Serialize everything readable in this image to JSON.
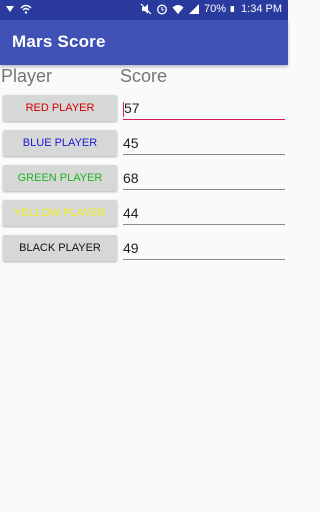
{
  "status_bar": {
    "battery": "70%",
    "time": "1:34 PM",
    "icons": [
      "notification-icon",
      "wifi-icon",
      "mute-icon",
      "alarm-icon",
      "wifi-icon",
      "signal-icon",
      "battery-icon"
    ]
  },
  "app": {
    "title": "Mars Score",
    "primary_color": "#3f51b5",
    "status_color": "#2a3a9e",
    "accent_color": "#d81b60"
  },
  "headers": {
    "player": "Player",
    "score": "Score"
  },
  "players": [
    {
      "label": "RED PLAYER",
      "color": "#d50000",
      "score": "57"
    },
    {
      "label": "BLUE PLAYER",
      "color": "#1a1ad6",
      "score": "45"
    },
    {
      "label": "GREEN PLAYER",
      "color": "#22b322",
      "score": "68"
    },
    {
      "label": "YELLOW PLAYER",
      "color": "#f2ef1f",
      "score": "44"
    },
    {
      "label": "BLACK PLAYER",
      "color": "#111111",
      "score": "49"
    }
  ]
}
